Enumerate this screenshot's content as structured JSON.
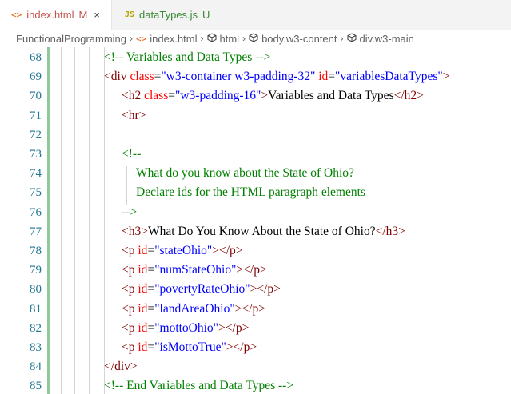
{
  "tabs": [
    {
      "icon": "<>",
      "label": "index.html",
      "badge": "M",
      "close": "×"
    },
    {
      "icon": "JS",
      "label": "dataTypes.js",
      "badge": "U"
    }
  ],
  "breadcrumb": [
    "FunctionalProgramming",
    "index.html",
    "html",
    "body.w3-content",
    "div.w3-main"
  ],
  "colors": {
    "comment": "#008000",
    "bracket": "#800000",
    "tag": "#800000",
    "attr": "#ff0000",
    "value": "#0000ff",
    "text": "#000000",
    "line_number": "#237893"
  },
  "lines": [
    {
      "n": "68",
      "tokens": [
        {
          "t": "comment",
          "v": "<!-- Variables and Data Types -->"
        }
      ]
    },
    {
      "n": "69",
      "tokens": [
        {
          "t": "bracket",
          "v": "<"
        },
        {
          "t": "tag",
          "v": "div"
        },
        {
          "t": "text",
          "v": " "
        },
        {
          "t": "attr",
          "v": "class"
        },
        {
          "t": "text",
          "v": "="
        },
        {
          "t": "value",
          "v": "\"w3-container w3-padding-32\""
        },
        {
          "t": "text",
          "v": " "
        },
        {
          "t": "attr",
          "v": "id"
        },
        {
          "t": "text",
          "v": "="
        },
        {
          "t": "value",
          "v": "\"variablesDataTypes\""
        },
        {
          "t": "bracket",
          "v": ">"
        }
      ]
    },
    {
      "n": "70",
      "tokens": [
        {
          "t": "bracket",
          "v": "<"
        },
        {
          "t": "tag",
          "v": "h2"
        },
        {
          "t": "text",
          "v": " "
        },
        {
          "t": "attr",
          "v": "class"
        },
        {
          "t": "text",
          "v": "="
        },
        {
          "t": "value",
          "v": "\"w3-padding-16\""
        },
        {
          "t": "bracket",
          "v": ">"
        },
        {
          "t": "text",
          "v": "Variables and Data Types"
        },
        {
          "t": "bracket",
          "v": "</"
        },
        {
          "t": "tag",
          "v": "h2"
        },
        {
          "t": "bracket",
          "v": ">"
        }
      ]
    },
    {
      "n": "71",
      "tokens": [
        {
          "t": "bracket",
          "v": "<"
        },
        {
          "t": "tag",
          "v": "hr"
        },
        {
          "t": "bracket",
          "v": ">"
        }
      ]
    },
    {
      "n": "72",
      "tokens": []
    },
    {
      "n": "73",
      "tokens": [
        {
          "t": "comment",
          "v": "<!--"
        }
      ]
    },
    {
      "n": "74",
      "tokens": [
        {
          "t": "comment",
          "v": "What do you know about the State of Ohio?"
        }
      ]
    },
    {
      "n": "75",
      "tokens": [
        {
          "t": "comment",
          "v": "Declare ids for the HTML paragraph elements"
        }
      ]
    },
    {
      "n": "76",
      "tokens": [
        {
          "t": "comment",
          "v": "-->"
        }
      ]
    },
    {
      "n": "77",
      "tokens": [
        {
          "t": "bracket",
          "v": "<"
        },
        {
          "t": "tag",
          "v": "h3"
        },
        {
          "t": "bracket",
          "v": ">"
        },
        {
          "t": "text",
          "v": "What Do You Know About the State of Ohio?"
        },
        {
          "t": "bracket",
          "v": "</"
        },
        {
          "t": "tag",
          "v": "h3"
        },
        {
          "t": "bracket",
          "v": ">"
        }
      ]
    },
    {
      "n": "78",
      "tokens": [
        {
          "t": "bracket",
          "v": "<"
        },
        {
          "t": "tag",
          "v": "p"
        },
        {
          "t": "text",
          "v": " "
        },
        {
          "t": "attr",
          "v": "id"
        },
        {
          "t": "text",
          "v": "="
        },
        {
          "t": "value",
          "v": "\"stateOhio\""
        },
        {
          "t": "bracket",
          "v": "></"
        },
        {
          "t": "tag",
          "v": "p"
        },
        {
          "t": "bracket",
          "v": ">"
        }
      ]
    },
    {
      "n": "79",
      "tokens": [
        {
          "t": "bracket",
          "v": "<"
        },
        {
          "t": "tag",
          "v": "p"
        },
        {
          "t": "text",
          "v": " "
        },
        {
          "t": "attr",
          "v": "id"
        },
        {
          "t": "text",
          "v": "="
        },
        {
          "t": "value",
          "v": "\"numStateOhio\""
        },
        {
          "t": "bracket",
          "v": "></"
        },
        {
          "t": "tag",
          "v": "p"
        },
        {
          "t": "bracket",
          "v": ">"
        }
      ]
    },
    {
      "n": "80",
      "tokens": [
        {
          "t": "bracket",
          "v": "<"
        },
        {
          "t": "tag",
          "v": "p"
        },
        {
          "t": "text",
          "v": " "
        },
        {
          "t": "attr",
          "v": "id"
        },
        {
          "t": "text",
          "v": "="
        },
        {
          "t": "value",
          "v": "\"povertyRateOhio\""
        },
        {
          "t": "bracket",
          "v": "></"
        },
        {
          "t": "tag",
          "v": "p"
        },
        {
          "t": "bracket",
          "v": ">"
        }
      ]
    },
    {
      "n": "81",
      "tokens": [
        {
          "t": "bracket",
          "v": "<"
        },
        {
          "t": "tag",
          "v": "p"
        },
        {
          "t": "text",
          "v": " "
        },
        {
          "t": "attr",
          "v": "id"
        },
        {
          "t": "text",
          "v": "="
        },
        {
          "t": "value",
          "v": "\"landAreaOhio\""
        },
        {
          "t": "bracket",
          "v": "></"
        },
        {
          "t": "tag",
          "v": "p"
        },
        {
          "t": "bracket",
          "v": ">"
        }
      ]
    },
    {
      "n": "82",
      "tokens": [
        {
          "t": "bracket",
          "v": "<"
        },
        {
          "t": "tag",
          "v": "p"
        },
        {
          "t": "text",
          "v": " "
        },
        {
          "t": "attr",
          "v": "id"
        },
        {
          "t": "text",
          "v": "="
        },
        {
          "t": "value",
          "v": "\"mottoOhio\""
        },
        {
          "t": "bracket",
          "v": "></"
        },
        {
          "t": "tag",
          "v": "p"
        },
        {
          "t": "bracket",
          "v": ">"
        }
      ]
    },
    {
      "n": "83",
      "tokens": [
        {
          "t": "bracket",
          "v": "<"
        },
        {
          "t": "tag",
          "v": "p"
        },
        {
          "t": "text",
          "v": " "
        },
        {
          "t": "attr",
          "v": "id"
        },
        {
          "t": "text",
          "v": "="
        },
        {
          "t": "value",
          "v": "\"isMottoTrue\""
        },
        {
          "t": "bracket",
          "v": "></"
        },
        {
          "t": "tag",
          "v": "p"
        },
        {
          "t": "bracket",
          "v": ">"
        }
      ]
    },
    {
      "n": "84",
      "tokens": [
        {
          "t": "bracket",
          "v": "</"
        },
        {
          "t": "tag",
          "v": "div"
        },
        {
          "t": "bracket",
          "v": ">"
        }
      ]
    },
    {
      "n": "85",
      "tokens": [
        {
          "t": "comment",
          "v": "<!-- End Variables and Data Types -->"
        }
      ]
    }
  ]
}
